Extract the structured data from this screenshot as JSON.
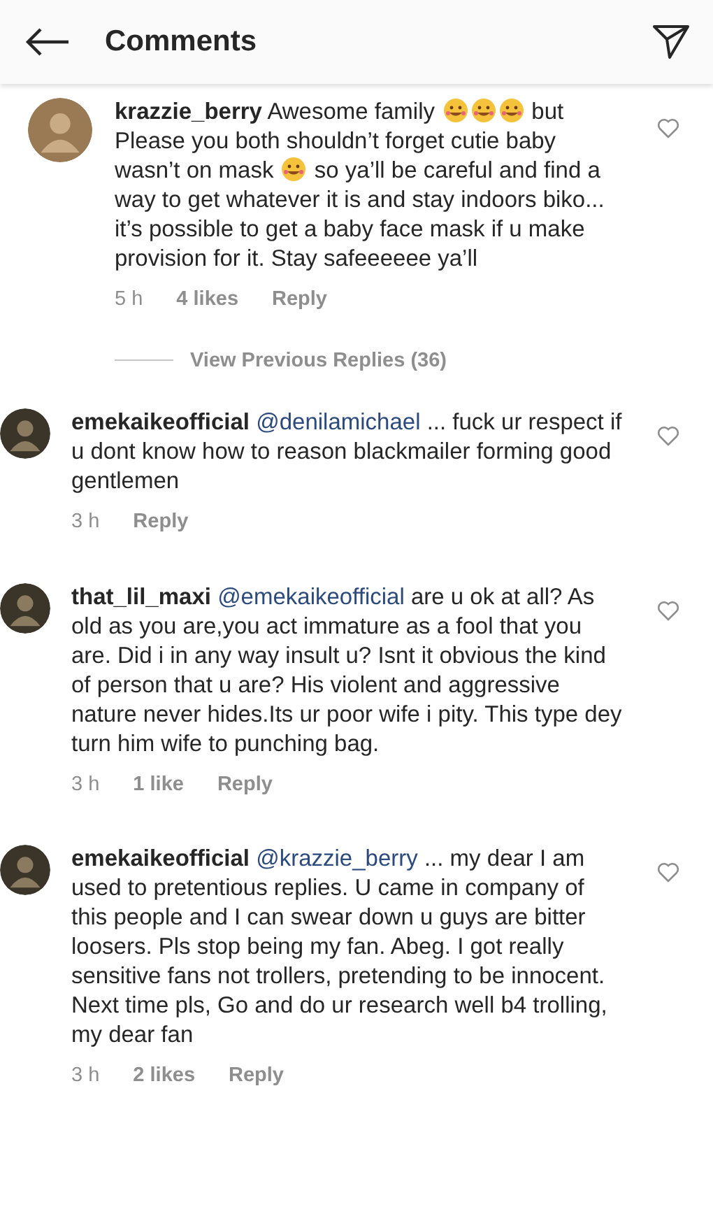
{
  "header": {
    "title": "Comments"
  },
  "comments": [
    {
      "username": "krazzie_berry",
      "liked": false,
      "body": [
        {
          "kind": "text",
          "text": "Awesome family "
        },
        {
          "kind": "emoji"
        },
        {
          "kind": "emoji"
        },
        {
          "kind": "emoji"
        },
        {
          "kind": "text",
          "text": " but Please you both shouldn’t forget cutie baby wasn’t on mask "
        },
        {
          "kind": "emoji"
        },
        {
          "kind": "text",
          "text": " so ya’ll be careful and find a way to get whatever it is and stay indoors biko... it’s possible to get a baby face mask if u make provision for it. Stay safeeeeee ya’ll"
        }
      ],
      "time": "5 h",
      "likes": "4 likes",
      "reply": "Reply",
      "view_replies": "View Previous Replies (36)",
      "children": [
        {
          "username": "emekaikeofficial",
          "liked": false,
          "body": [
            {
              "kind": "mention",
              "text": "@denilamichael"
            },
            {
              "kind": "text",
              "text": " ... fuck ur respect if u dont know how to reason blackmailer forming good gentlemen"
            }
          ],
          "time": "3 h",
          "reply": "Reply"
        },
        {
          "username": "that_lil_maxi",
          "liked": false,
          "body": [
            {
              "kind": "mention",
              "text": "@emekaikeofficial"
            },
            {
              "kind": "text",
              "text": " are u ok at all? As old as you are,you act immature as a fool that you are. Did i in any way insult u? Isnt it obvious the kind of person that u are? His violent and aggressive nature never hides.Its ur poor wife i pity. This type dey turn him wife to punching bag."
            }
          ],
          "time": "3 h",
          "likes": "1 like",
          "reply": "Reply"
        },
        {
          "username": "emekaikeofficial",
          "liked": false,
          "body": [
            {
              "kind": "mention",
              "text": "@krazzie_berry"
            },
            {
              "kind": "text",
              "text": " ... my dear I am used to pretentious replies. U came in company of this people and I can swear down u guys are bitter loosers. Pls stop being my fan. Abeg. I got really sensitive fans not trollers, pretending to be innocent. Next time pls, Go and do ur research well b4 trolling, my dear fan"
            }
          ],
          "time": "3 h",
          "likes": "2 likes",
          "reply": "Reply"
        }
      ]
    }
  ]
}
